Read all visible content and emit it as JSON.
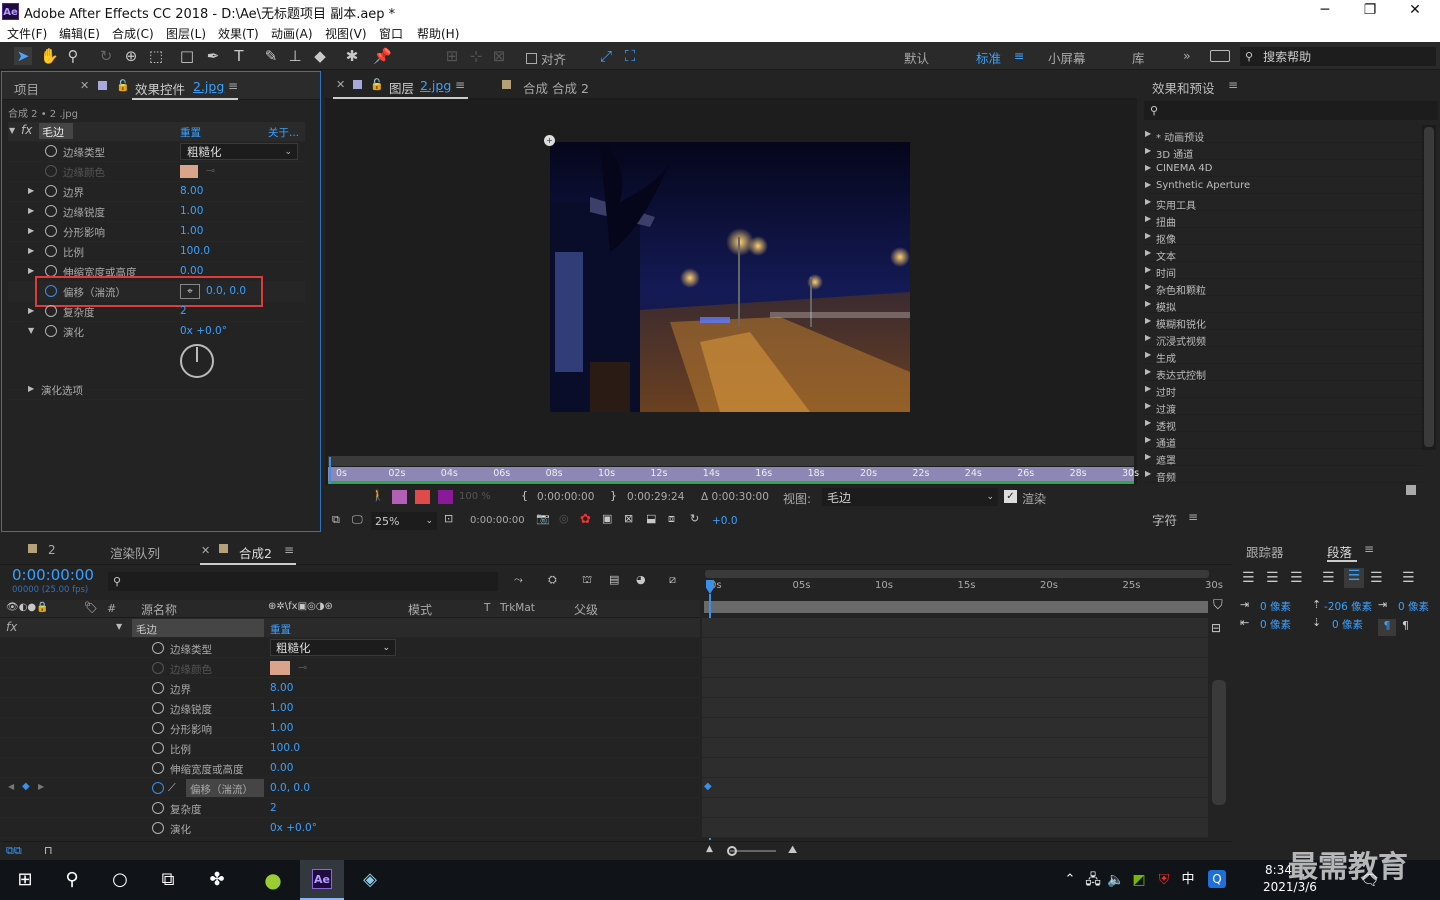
{
  "window": {
    "title": "Adobe After Effects CC 2018 - D:\\Ae\\无标题项目 副本.aep *",
    "icon": "Ae"
  },
  "menu": [
    "文件(F)",
    "编辑(E)",
    "合成(C)",
    "图层(L)",
    "效果(T)",
    "动画(A)",
    "视图(V)",
    "窗口",
    "帮助(H)"
  ],
  "toolbar": {
    "align_label": "对齐",
    "workspaces": [
      "默认",
      "标准",
      "小屏幕",
      "库"
    ],
    "active_workspace": "标准",
    "search_placeholder": "搜索帮助"
  },
  "left_panel": {
    "tab_project": "项目",
    "tab_effects": "效果控件",
    "tab_effects_file": "2.jpg",
    "breadcrumb": "合成 2 • 2 .jpg",
    "effect": {
      "name": "毛边",
      "reset": "重置",
      "about": "关于..."
    },
    "props": [
      {
        "label": "边缘类型",
        "value": "粗糙化",
        "type": "dropdown"
      },
      {
        "label": "边缘颜色",
        "value": "",
        "type": "color"
      },
      {
        "label": "边界",
        "value": "8.00"
      },
      {
        "label": "边缘锐度",
        "value": "1.00"
      },
      {
        "label": "分形影响",
        "value": "1.00"
      },
      {
        "label": "比例",
        "value": "100.0"
      },
      {
        "label": "伸缩宽度或高度",
        "value": "0.00"
      },
      {
        "label": "偏移（湍流）",
        "value": "0.0, 0.0",
        "highlight": true
      },
      {
        "label": "复杂度",
        "value": "2"
      },
      {
        "label": "演化",
        "value": "0x +0.0°"
      }
    ],
    "evolution_options": "演化选项"
  },
  "viewer": {
    "tab_layer": "图层",
    "tab_layer_file": "2.jpg",
    "tab_comp": "合成 合成 2",
    "ruler": [
      "0s",
      "02s",
      "04s",
      "06s",
      "08s",
      "10s",
      "12s",
      "14s",
      "16s",
      "18s",
      "20s",
      "22s",
      "24s",
      "26s",
      "28s",
      "30s"
    ],
    "opacity": "100 %",
    "in_time": "0:00:00:00",
    "out_time": "0:00:29:24",
    "duration": "Δ 0:00:30:00",
    "view_label": "视图:",
    "view_value": "毛边",
    "render_label": "渲染",
    "zoom": "25%",
    "current_time": "0:00:00:00",
    "exposure": "+0.0"
  },
  "right_panel": {
    "title": "效果和预设",
    "items": [
      "* 动画预设",
      "3D 通道",
      "CINEMA 4D",
      "Synthetic Aperture",
      "实用工具",
      "扭曲",
      "抠像",
      "文本",
      "时间",
      "杂色和颗粒",
      "模拟",
      "模糊和锐化",
      "沉浸式视频",
      "生成",
      "表达式控制",
      "过时",
      "过渡",
      "透视",
      "通道",
      "遮罩",
      "音频"
    ],
    "char_tab": "字符",
    "tracker_tab": "跟踪器",
    "para_tab": "段落",
    "para_values": [
      "0 像素",
      "-206 像素",
      "0 像素",
      "0 像素",
      "0 像素"
    ]
  },
  "timeline": {
    "tab_render": "渲染队列",
    "tab_comp": "合成2",
    "comp_index": "2",
    "timecode": "0:00:00:00",
    "fps": "00000 (25.00 fps)",
    "col_source": "源名称",
    "col_mode": "模式",
    "col_t": "T",
    "col_trkmat": "TrkMat",
    "col_parent": "父级",
    "col_hash": "#",
    "layer_effect": "毛边",
    "reset": "重置",
    "ruler": [
      "0s",
      "05s",
      "10s",
      "15s",
      "20s",
      "25s",
      "30s"
    ]
  },
  "taskbar": {
    "time": "8:34",
    "date": "2021/3/6",
    "ime": "中",
    "watermark": "最需教育"
  },
  "colors": {
    "accent": "#3aa0ff",
    "edge_color": "#d9a48a",
    "highlight_box": "#e03a3a"
  }
}
